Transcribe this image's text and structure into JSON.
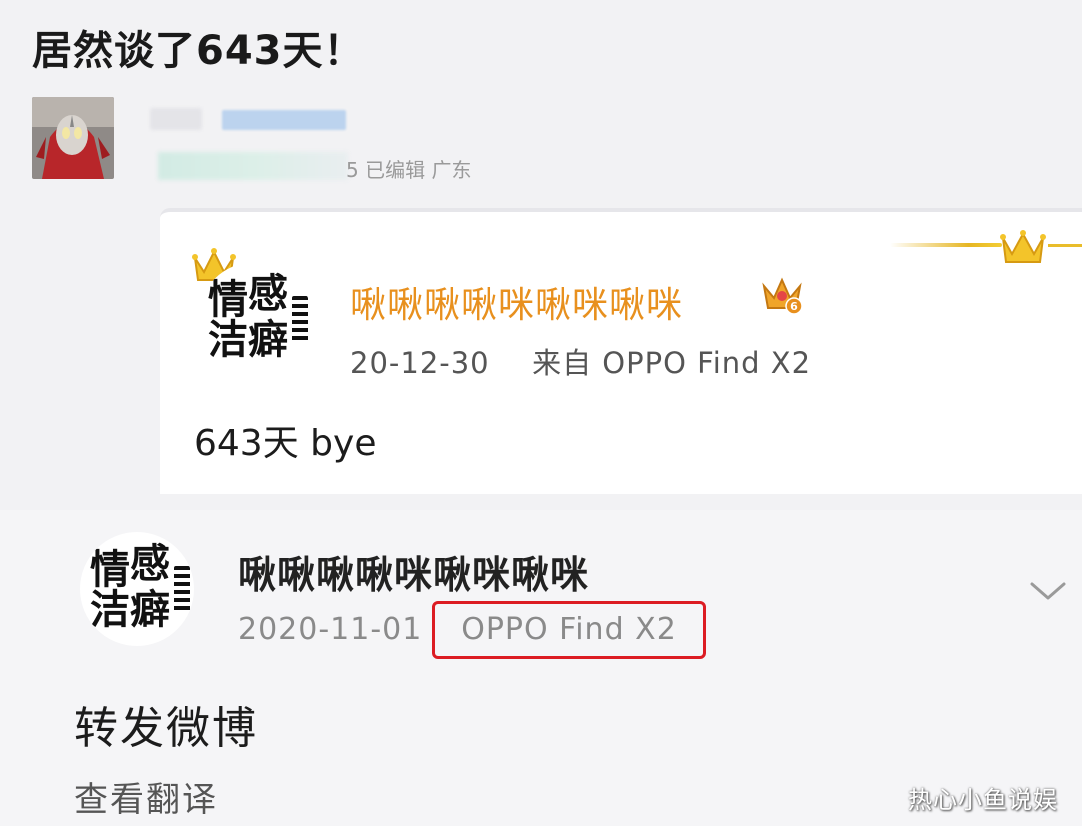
{
  "page": {
    "title": "居然谈了643天！"
  },
  "poster": {
    "meta_suffix": "5 已编辑 广东"
  },
  "repost": {
    "author_name": "啾啾啾啾咪啾咪啾咪",
    "vip_level": "6",
    "date": "20-12-30",
    "source": "来自 OPPO Find X2",
    "text": "643天 bye"
  },
  "original": {
    "author_name": "啾啾啾啾咪啾咪啾咪",
    "date": "2020-11-01",
    "device": "OPPO Find X2",
    "text": "转发微博",
    "translate_label": "查看翻译"
  },
  "avatar": {
    "char_1": "情",
    "char_2": "感",
    "char_3": "洁",
    "char_4": "癖"
  },
  "watermark": "热心小鱼说娱",
  "icons": {
    "crown": "crown-icon",
    "vip": "vip-crown-badge-icon",
    "expand": "chevron-down-icon"
  },
  "colors": {
    "name_orange": "#e8901e",
    "highlight_red": "#dc1c23",
    "gold": "#e6b623"
  }
}
